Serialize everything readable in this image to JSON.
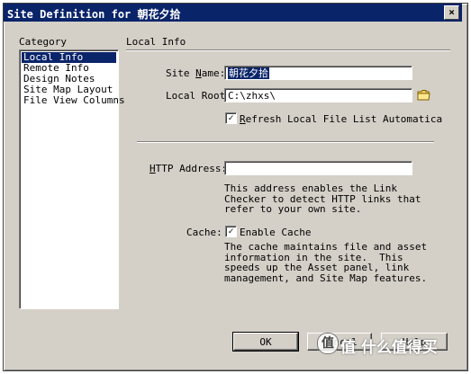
{
  "dialog": {
    "title": "Site Definition for 朝花夕拾",
    "close_label": "×"
  },
  "category": {
    "header": "Category",
    "items": [
      {
        "label": "Local Info",
        "selected": true
      },
      {
        "label": "Remote Info",
        "selected": false
      },
      {
        "label": "Design Notes",
        "selected": false
      },
      {
        "label": "Site Map Layout",
        "selected": false
      },
      {
        "label": "File View Columns",
        "selected": false
      }
    ]
  },
  "panel": {
    "header": "Local Info",
    "site_name_label_pre": "Site ",
    "site_name_label_key": "N",
    "site_name_label_post": "ame:",
    "site_name_value": "朝花夕拾",
    "local_root_label": "Local Root",
    "local_root_value": "C:\\zhxs\\",
    "folder_icon": "folder-icon",
    "refresh_label_key": "R",
    "refresh_label_rest": "efresh Local File List Automatica",
    "refresh_checked": true,
    "http_label_key": "H",
    "http_label_rest": "TTP Address:",
    "http_value": "",
    "http_note": "This address enables the Link\nChecker to detect HTTP links that\nrefer to your own site.",
    "cache_label": "Cache:",
    "cache_checked": true,
    "cache_check_label": "Enable Cache",
    "cache_note": "The cache maintains file and asset\ninformation in the site.  This\nspeeds up the Asset panel, link\nmanagement, and Site Map features."
  },
  "buttons": {
    "ok": "OK",
    "cancel": "Cancel",
    "help": "Help"
  },
  "watermark": {
    "text": "值 什么值得买",
    "logo": "值"
  },
  "colors": {
    "titlebar": "#0a246a",
    "face": "#d4d0c8",
    "selection": "#0a246a"
  }
}
